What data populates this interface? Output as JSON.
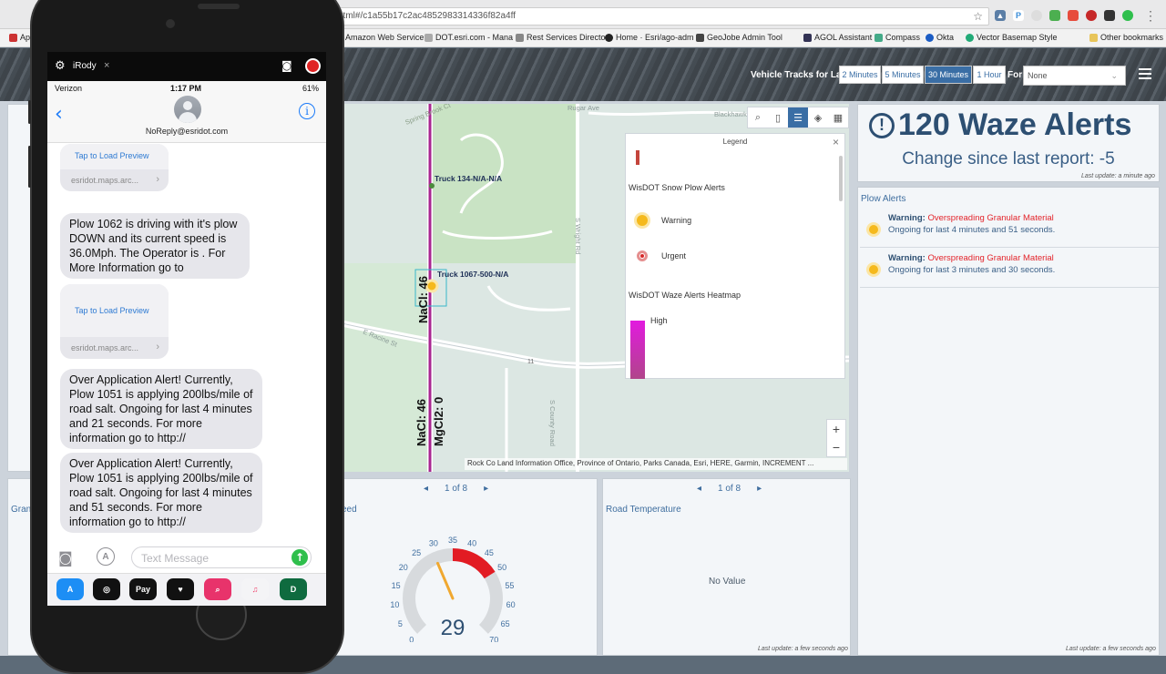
{
  "browser": {
    "address": "html#/c1a55b17c2ac4852983314336f82a4ff",
    "bookmarks": [
      "Ap",
      "Amazon Web Service",
      "DOT.esri.com - Mana",
      "Rest Services Director",
      "Home · Esri/ago-adm",
      "GeoJobe Admin Tool",
      "AGOL Assistant",
      "Compass",
      "Okta",
      "Vector Basemap Style",
      "Other bookmarks"
    ]
  },
  "header": {
    "vehicle_tracks_label": "Vehicle Tracks for Last",
    "time_buttons": [
      "2 Minutes",
      "5 Minutes",
      "30 Minutes",
      "1 Hour"
    ],
    "for_label": "For",
    "for_value": "None"
  },
  "map": {
    "truck_labels": [
      "Truck 134-N/A-N/A",
      "Truck 1067-500-N/A"
    ],
    "salt_labels": [
      "NaCl: 46",
      "NaCl: 46",
      "MgCl2: 0"
    ],
    "road_labels": [
      "Spring Brook Ct",
      "Rugar Ave",
      "Blackhawk",
      "S Wright Rd",
      "E Racine St",
      "S County Road",
      "11"
    ],
    "attribution": "Rock Co Land Information Office, Province of Ontario, Parks Canada, Esri, HERE, Garmin, INCREMENT ...",
    "zoom_in": "+",
    "zoom_out": "−"
  },
  "legend": {
    "title": "Legend",
    "section1": "WisDOT Snow Plow Alerts",
    "warning": "Warning",
    "urgent": "Urgent",
    "section2": "WisDOT Waze Alerts Heatmap",
    "high": "High"
  },
  "waze": {
    "count_text": "120 Waze Alerts",
    "change_text": "Change since last report: -5",
    "last_update": "Last update: a minute ago"
  },
  "plow_alerts": {
    "title": "Plow Alerts",
    "items": [
      {
        "label": "Warning:",
        "message": "Overspreading Granular Material",
        "ongoing": "Ongoing for last 4 minutes and 51 seconds."
      },
      {
        "label": "Warning:",
        "message": "Overspreading Granular Material",
        "ongoing": "Ongoing for last 3 minutes and 30 seconds."
      }
    ],
    "last_update": "Last update: a few seconds ago"
  },
  "bottom_panels": {
    "left_title": "Gran",
    "speed_title": "eed",
    "speed_pager": "1 of 8",
    "speed_value": "29",
    "gauge_ticks": [
      "0",
      "5",
      "10",
      "15",
      "20",
      "25",
      "30",
      "35",
      "40",
      "45",
      "50",
      "55",
      "60",
      "65",
      "70"
    ],
    "road_temp_title": "Road Temperature",
    "road_temp_pager": "1 of 8",
    "no_value": "No Value",
    "last_update": "Last update: a few seconds ago"
  },
  "gauge_data": {
    "min": 0,
    "max": 70,
    "value": 29,
    "red_start": 35,
    "red_end": 50
  },
  "phone": {
    "recorder_title": "iRody",
    "carrier": "Verizon",
    "time": "1:17 PM",
    "battery": "61%",
    "contact": "NoReply@esridot.com",
    "link_preview": "Tap to Load Preview",
    "link_domain": "esridot.maps.arc...",
    "messages": [
      "Plow 1062 is driving with it's plow DOWN and its current speed is 36.0Mph. The Operator is . For More Information go to",
      "Over Application Alert! Currently, Plow 1051 is applying 200lbs/mile of road salt. Ongoing for last 4 minutes and 21 seconds. For more information go to http://",
      "Over Application Alert! Currently, Plow 1051 is applying 200lbs/mile of road salt. Ongoing for last 4 minutes and 51 seconds. For more information go to http://"
    ],
    "input_placeholder": "Text Message"
  }
}
